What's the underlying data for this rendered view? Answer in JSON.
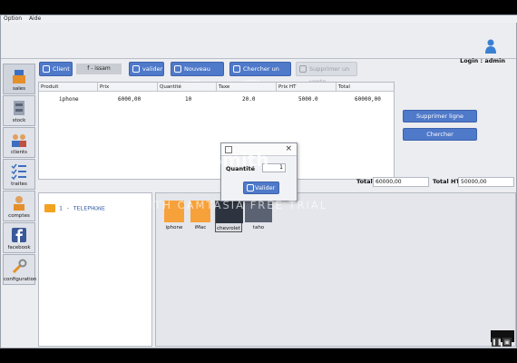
{
  "menu": {
    "items": [
      "Option",
      "Aide"
    ]
  },
  "header": {
    "login_label": "Login : admin"
  },
  "sidebar": {
    "items": [
      {
        "label": "sales",
        "icon": "cash-register-icon"
      },
      {
        "label": "stock",
        "icon": "stock-icon"
      },
      {
        "label": "clients",
        "icon": "clients-icon"
      },
      {
        "label": "traites",
        "icon": "checklist-icon"
      },
      {
        "label": "comptes",
        "icon": "accounts-icon"
      },
      {
        "label": "facebook",
        "icon": "facebook-icon"
      },
      {
        "label": "configuration",
        "icon": "tools-icon"
      }
    ]
  },
  "toolbar": {
    "client_label": "Client",
    "user_value": "f - issam",
    "valider_label": "valider",
    "nouveau_label": "Nouveau vente",
    "chercher_label": "Chercher un vente",
    "supprimer_label": "Supprimer un vente"
  },
  "table": {
    "columns": [
      "Produit",
      "Prix",
      "Quantité",
      "Taxe",
      "Prix HT",
      "Total"
    ],
    "rows": [
      {
        "produit": "iphone",
        "prix": "6000,00",
        "quantite": "10",
        "taxe": "20.0",
        "prix_ht": "5000.0",
        "total": "60000,00"
      }
    ]
  },
  "actions": {
    "supprimer_ligne": "Supprimer ligne",
    "chercher": "Chercher"
  },
  "totals": {
    "total_label": "Total",
    "total_value": "60000,00",
    "total_ht_label": "Total HT",
    "total_ht_value": "50000,00"
  },
  "category_tree": {
    "item": "1 - TELEPHONE"
  },
  "products": [
    {
      "name": "iphone"
    },
    {
      "name": "iMac"
    },
    {
      "name": "chevrolet"
    },
    {
      "name": "taho"
    }
  ],
  "dialog": {
    "quantity_label": "Quantité",
    "quantity_value": "1",
    "validate_label": "Valider"
  },
  "watermark": {
    "line1": "TechSmith",
    "line2": "MADE WITH CAMTASIA FREE TRIAL"
  },
  "colors": {
    "accent": "#4f79c9",
    "folder": "#f2a320"
  }
}
